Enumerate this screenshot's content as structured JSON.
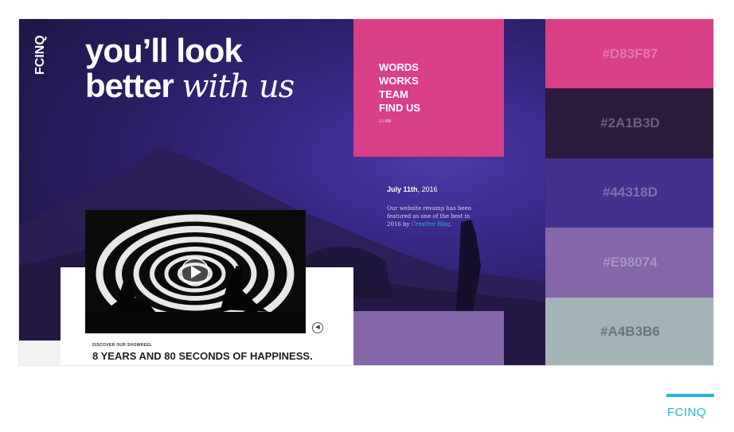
{
  "hero": {
    "logo": "FCINQ",
    "headline_line1": "you’ll look",
    "headline_line2_bold": "better",
    "headline_line2_script": "with us"
  },
  "menu": {
    "items": [
      "WORDS",
      "WORKS",
      "TEAM",
      "FIND US"
    ],
    "languages": [
      "EN",
      "FR"
    ]
  },
  "news": {
    "date_bold": "July 11th",
    "date_year": ", 2016",
    "text": "Our website revamp has been featured as one of the best in 2016 by ",
    "link": "Creative Bloq",
    "text_end": "."
  },
  "video": {
    "caption_small": "DISCOVER OUR SHOWREEL",
    "caption_big": "8 YEARS AND 80 SECONDS OF HAPPINESS.",
    "sound_icon": "speaker-icon",
    "play_icon": "play-icon"
  },
  "palette": [
    {
      "hex_label": "#D83F87",
      "color": "#d83f87"
    },
    {
      "hex_label": "#2A1B3D",
      "color": "#2a1b3d"
    },
    {
      "hex_label": "#44318D",
      "color": "#44318d"
    },
    {
      "hex_label": "#E98074",
      "color": "#8466a9"
    },
    {
      "hex_label": "#A4B3B6",
      "color": "#a4b3b6"
    }
  ],
  "source": {
    "label": "FCINQ"
  }
}
